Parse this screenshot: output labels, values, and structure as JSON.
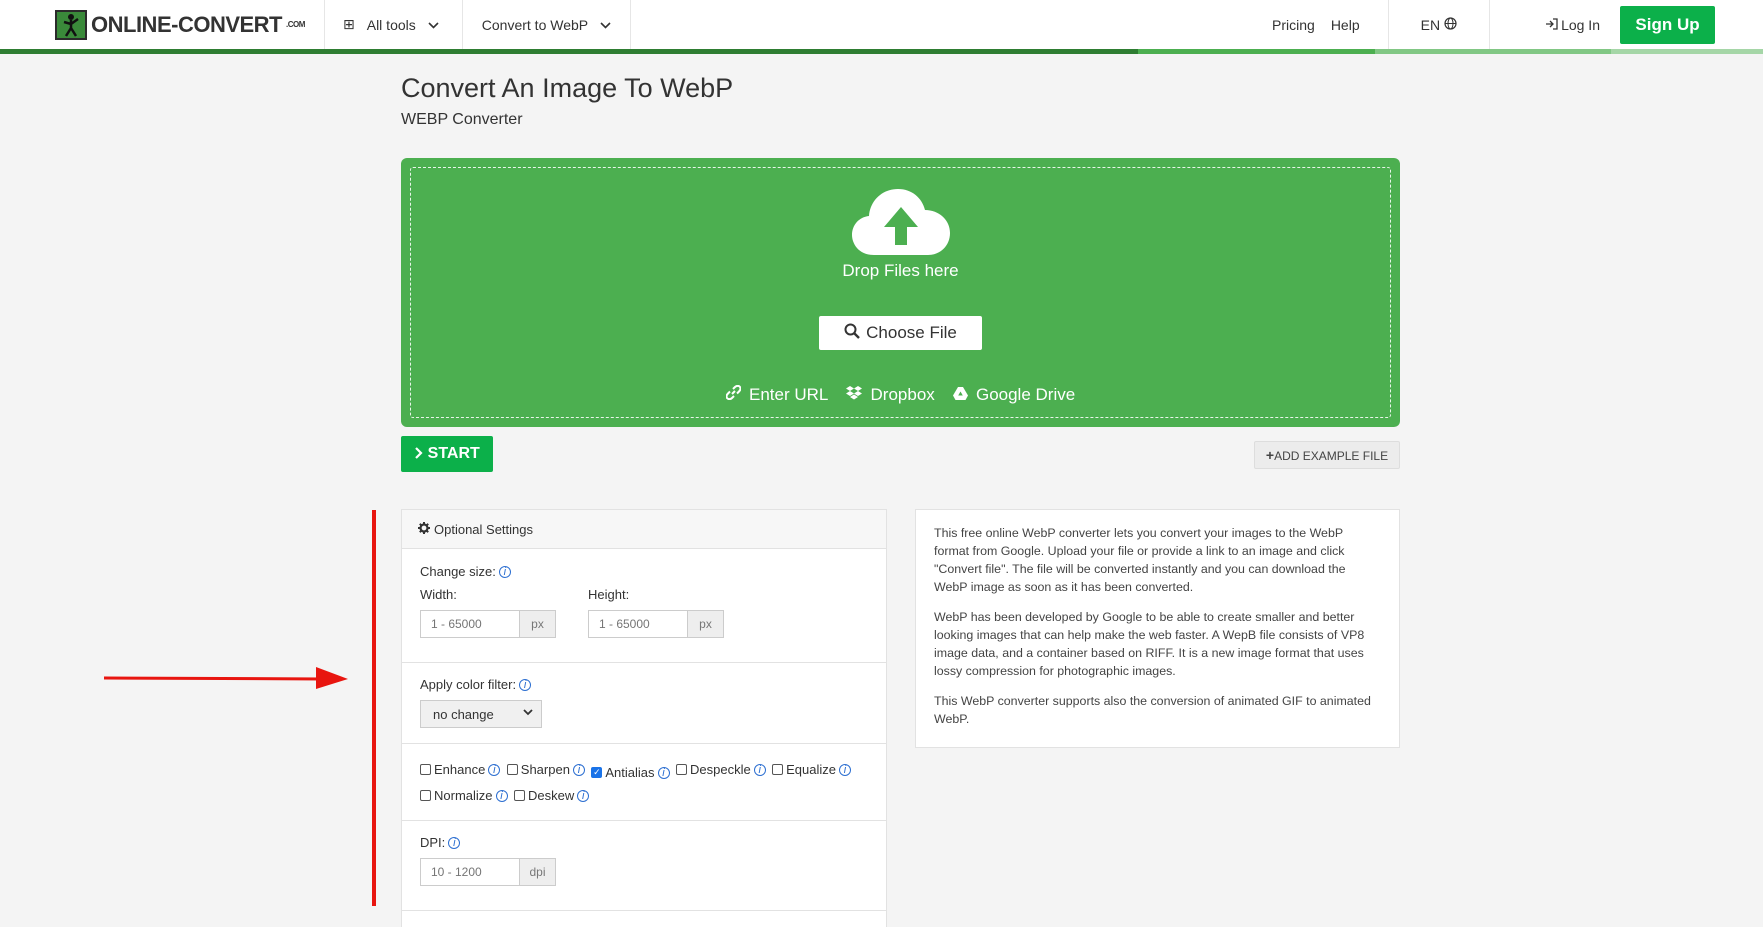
{
  "header": {
    "logo_text": "ONLINE-CONVERT",
    "logo_suffix": ".COM",
    "all_tools": "All tools",
    "convert_menu": "Convert to WebP",
    "pricing": "Pricing",
    "help": "Help",
    "language": "EN",
    "login": "Log In",
    "signup": "Sign Up",
    "bar_colors": [
      "#2e7d32",
      "#43a047",
      "#66bb6a",
      "#a5d6a7"
    ]
  },
  "page": {
    "title": "Convert An Image To WebP",
    "subtitle": "WEBP Converter"
  },
  "upload": {
    "drop_text": "Drop Files here",
    "choose_file": "Choose File",
    "enter_url": "Enter URL",
    "dropbox": "Dropbox",
    "google_drive": "Google Drive",
    "bg_color": "#4caf50"
  },
  "actions": {
    "start": "START",
    "add_example": "ADD EXAMPLE FILE"
  },
  "settings": {
    "title": "Optional Settings",
    "change_size": "Change size:",
    "width_label": "Width:",
    "height_label": "Height:",
    "width_placeholder": "1 - 65000",
    "height_placeholder": "1 - 65000",
    "px_unit": "px",
    "color_filter_label": "Apply color filter:",
    "color_filter_value": "no change",
    "checkboxes": [
      {
        "label": "Enhance",
        "checked": false
      },
      {
        "label": "Sharpen",
        "checked": false
      },
      {
        "label": "Antialias",
        "checked": true
      },
      {
        "label": "Despeckle",
        "checked": false
      },
      {
        "label": "Equalize",
        "checked": false
      },
      {
        "label": "Normalize",
        "checked": false
      },
      {
        "label": "Deskew",
        "checked": false
      }
    ],
    "dpi_label": "DPI:",
    "dpi_placeholder": "10 - 1200",
    "dpi_unit": "dpi"
  },
  "description": {
    "p1": "This free online WebP converter lets you convert your images to the WebP format from Google. Upload your file or provide a link to an image and click \"Convert file\". The file will be converted instantly and you can download the WebP image as soon as it has been converted.",
    "p2": "WebP has been developed by Google to be able to create smaller and better looking images that can help make the web faster. A WepB file consists of VP8 image data, and a container based on RIFF. It is a new image format that uses lossy compression for photographic images.",
    "p3": "This WebP converter supports also the conversion of animated GIF to animated WebP."
  },
  "annotation_color": "#e8150f"
}
